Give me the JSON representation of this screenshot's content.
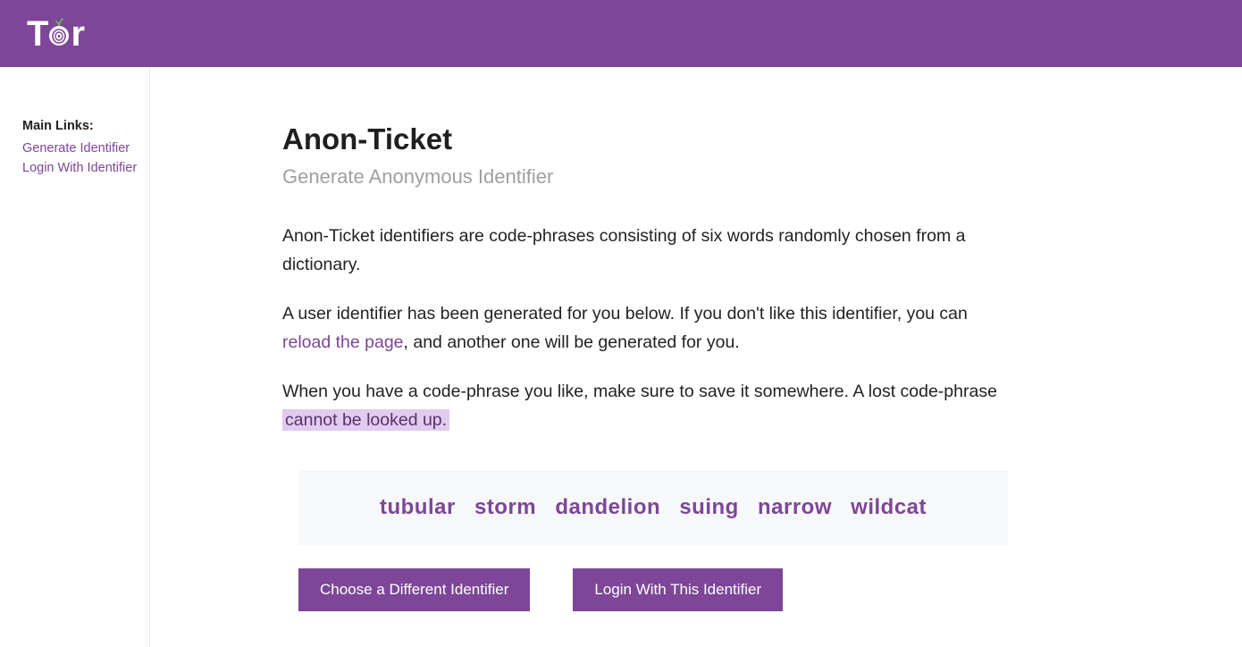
{
  "sidebar": {
    "title": "Main Links:",
    "link_generate": "Generate Identifier",
    "link_login": "Login With Identifier"
  },
  "page": {
    "title": "Anon-Ticket",
    "subtitle": "Generate Anonymous Identifier",
    "p1": "Anon-Ticket identifiers are code-phrases consisting of six words randomly chosen from a dictionary.",
    "p2_a": "A user identifier has been generated for you below. If you don't like this identifier, you can ",
    "p2_link": "reload the page",
    "p2_b": ", and another one will be generated for you.",
    "p3_a": "When you have a code-phrase you like, make sure to save it somewhere. A lost code-phrase ",
    "p3_mark": "cannot be looked up."
  },
  "identifier": {
    "words": "tubular   storm   dandelion   suing   narrow   wildcat"
  },
  "buttons": {
    "choose": "Choose a Different Identifier",
    "login": "Login With This Identifier"
  }
}
